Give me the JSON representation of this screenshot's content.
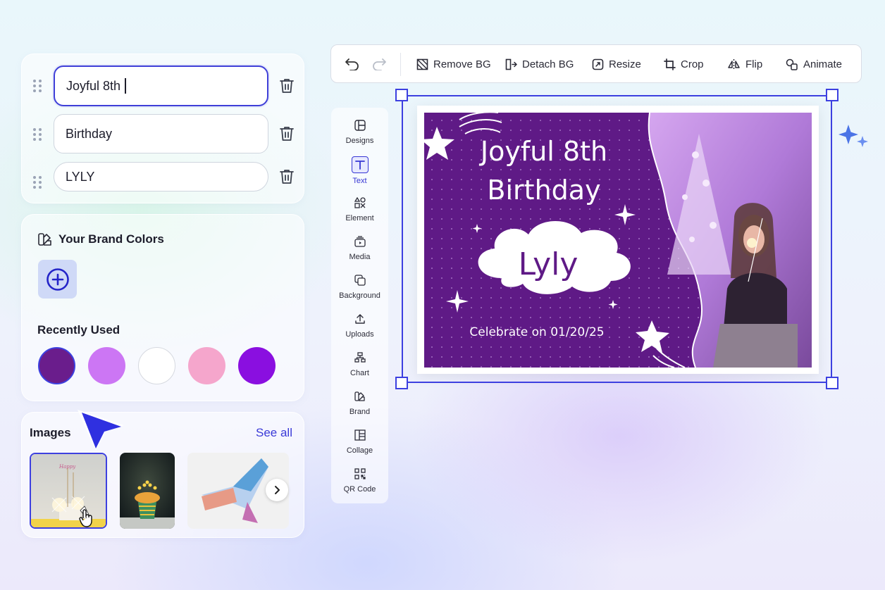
{
  "text_fields": [
    {
      "value": "Joyful 8th",
      "active": true
    },
    {
      "value": "Birthday",
      "active": false
    },
    {
      "value": "LYLY",
      "active": false
    }
  ],
  "brand": {
    "title": "Your Brand Colors",
    "recent_title": "Recently Used",
    "recent_colors": [
      "#6a1d8c",
      "#cc76f4",
      "#ffffff",
      "#f5a6cc",
      "#8a0fe0"
    ]
  },
  "images": {
    "title": "Images",
    "see_all": "See all"
  },
  "toolbar": {
    "remove_bg": "Remove BG",
    "detach_bg": "Detach BG",
    "resize": "Resize",
    "crop": "Crop",
    "flip": "Flip",
    "animate": "Animate"
  },
  "side_nav": {
    "designs": "Designs",
    "text": "Text",
    "element": "Element",
    "media": "Media",
    "background": "Background",
    "uploads": "Uploads",
    "chart": "Chart",
    "brand": "Brand",
    "collage": "Collage",
    "qr_code": "QR Code"
  },
  "design": {
    "line1": "Joyful 8th",
    "line2": "Birthday",
    "name": "Lyly",
    "celebrate": "Celebrate on 01/20/25",
    "bg_color": "#5f1a86"
  },
  "colors": {
    "accent": "#3d40e0",
    "link": "#3a3ad8"
  }
}
